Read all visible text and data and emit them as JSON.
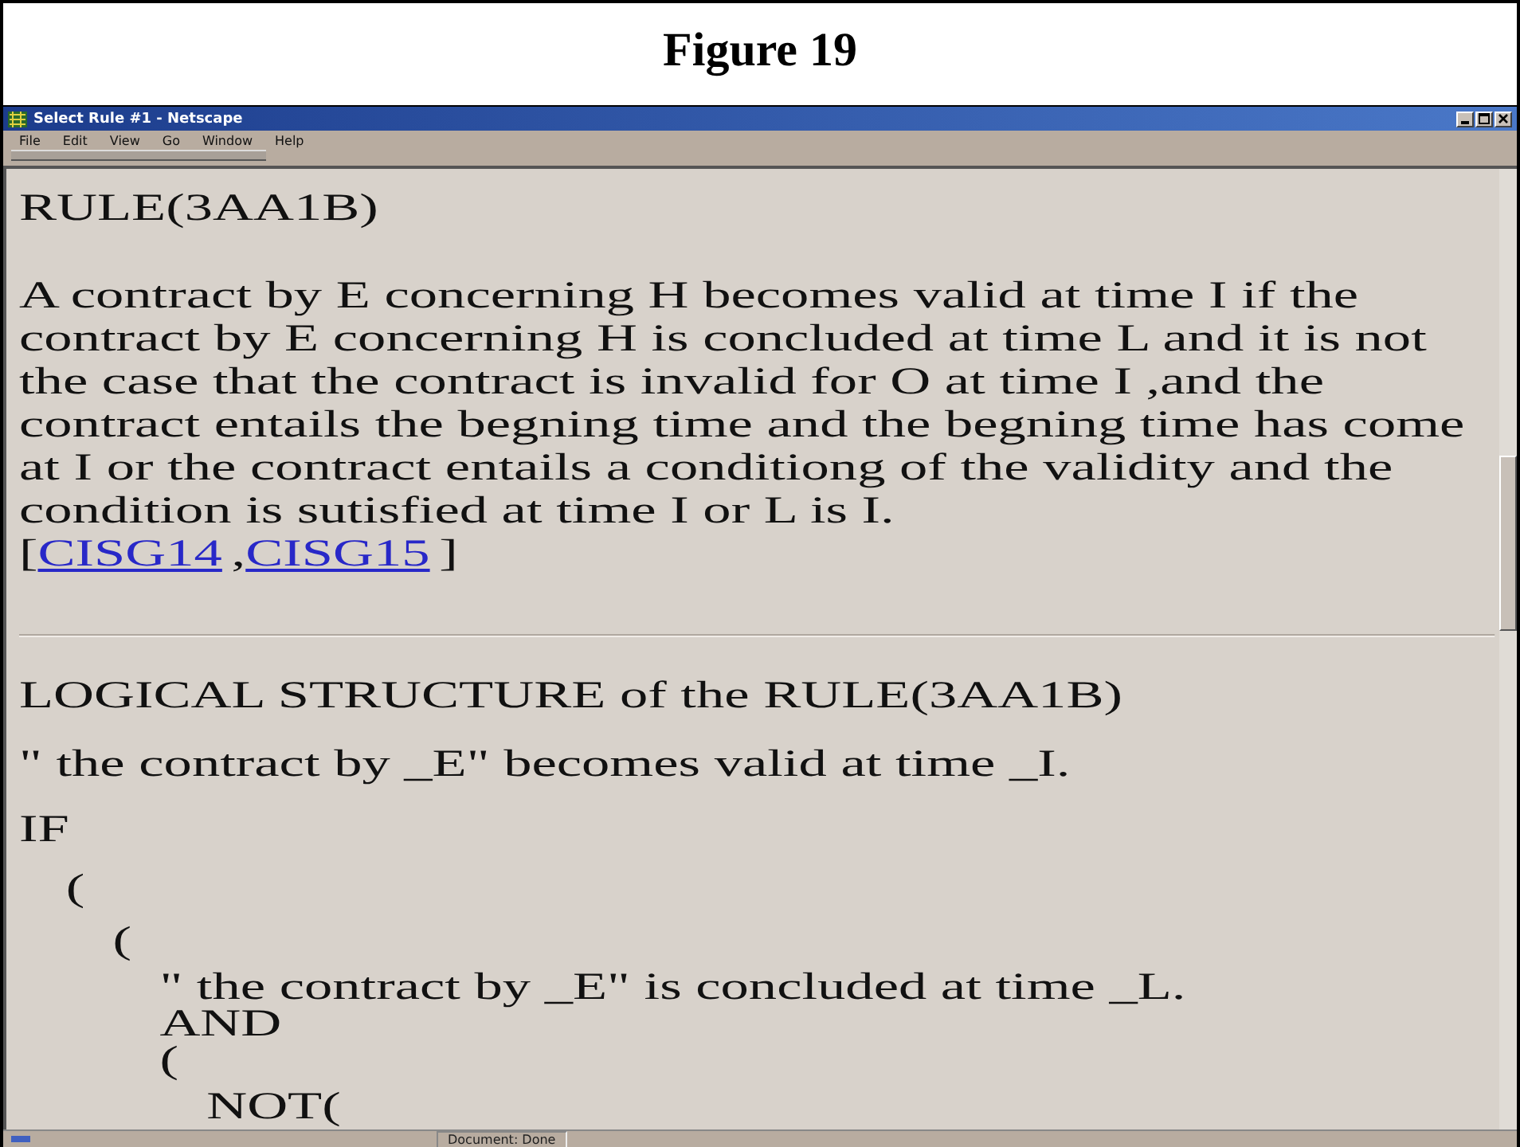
{
  "figure": {
    "title": "Figure 19"
  },
  "window": {
    "title": "Select Rule #1 - Netscape"
  },
  "menu": [
    "File",
    "Edit",
    "View",
    "Go",
    "Window",
    "Help"
  ],
  "content": {
    "rule_title": "RULE(3AA1B)",
    "paragraph": "A contract by E concerning H becomes valid at time I if the contract by E concerning H is concluded at time L and it is not the case that the contract is invalid for O at time I ,and the contract entails the begning time and the begning time has come at I or the contract entails a conditiong of the validity and the condition is sutisfied at time I or L is I.",
    "references": {
      "open": "[",
      "links": [
        "CISG14",
        "CISG15"
      ],
      "separator": ",",
      "close": "]"
    },
    "structure_title": "LOGICAL STRUCTURE of the RULE(3AA1B)",
    "statement": "\" the contract by _E\" becomes valid at time _I.",
    "logic": [
      {
        "text": "IF",
        "children": [
          {
            "text": "(",
            "children": [
              {
                "text": "(",
                "children": [
                  {
                    "text": "\" the contract by _E\" is concluded at time _L."
                  },
                  {
                    "text": "AND"
                  },
                  {
                    "text": "(",
                    "children": [
                      {
                        "text": "NOT("
                      }
                    ]
                  }
                ]
              }
            ]
          }
        ]
      }
    ]
  },
  "status_bar": {
    "text": "Document: Done"
  }
}
